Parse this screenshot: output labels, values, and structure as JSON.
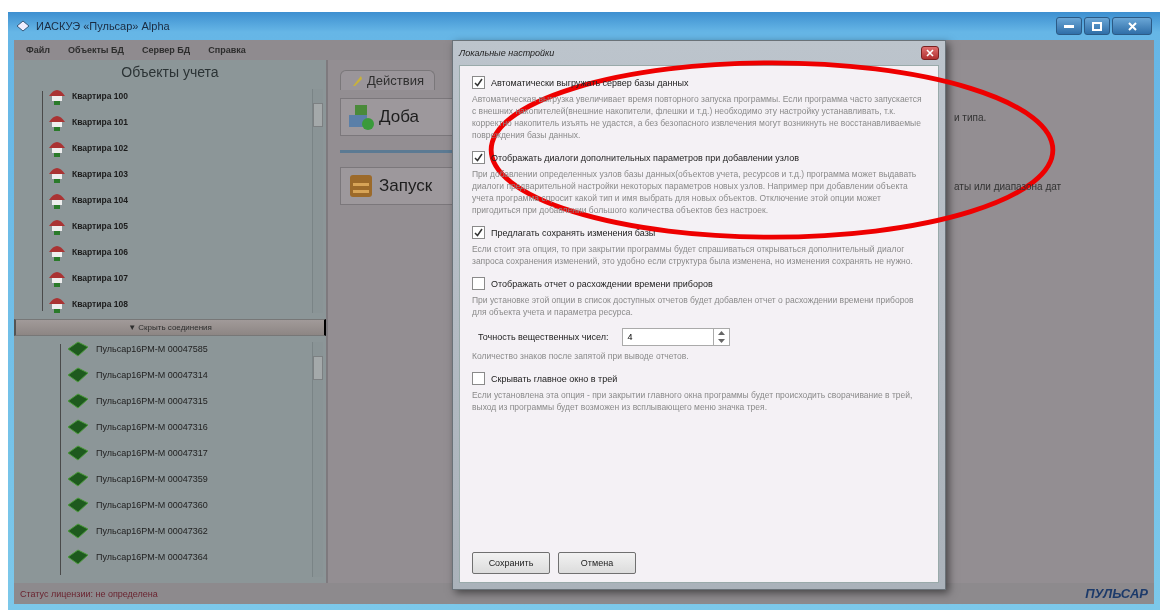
{
  "window": {
    "title": "ИАСКУЭ «Пульсар» Alpha"
  },
  "menu": [
    "Файл",
    "Объекты БД",
    "Сервер БД",
    "Справка"
  ],
  "objects_panel": {
    "title": "Объекты учета",
    "items": [
      "Квартира 100",
      "Квартира 101",
      "Квартира 102",
      "Квартира 103",
      "Квартира 104",
      "Квартира 105",
      "Квартира 106",
      "Квартира 107",
      "Квартира 108"
    ]
  },
  "connections_toggle": {
    "icon": "▼",
    "label": "Скрыть соединения"
  },
  "devices": [
    "Пульсар16РМ-М 00047585",
    "Пульсар16РМ-М 00047314",
    "Пульсар16РМ-М 00047315",
    "Пульсар16РМ-М 00047316",
    "Пульсар16РМ-М 00047317",
    "Пульсар16РМ-М 00047359",
    "Пульсар16РМ-М 00047360",
    "Пульсар16РМ-М 00047362",
    "Пульсар16РМ-М 00047364"
  ],
  "actions": {
    "tab": "Действия",
    "items": [
      {
        "kind": "add",
        "label": "Доба",
        "note": "и типа."
      },
      {
        "kind": "run",
        "label": "Запуск",
        "note": "аты или диапазона дат"
      }
    ]
  },
  "status_bar": "Статус лицензии:  не определена",
  "logo": "ПУЛЬСАР",
  "dialog": {
    "title": "Локальные настройки",
    "settings": [
      {
        "kind": "checkbox",
        "label": "Автоматически выгружать сервер базы данных",
        "checked": true,
        "description": "Автоматическая выгрузка увеличивает время повторного запуска программы. Если программа часто запускается с внешних накопителей(внешние накопители, флешки и т.д.) необходимо эту настройку устанавливать, т.к. корректно накопитель изъять не удастся, а без безопасного извлечения могут возникнуть не восстанавливаемые повреждения базы данных."
      },
      {
        "kind": "checkbox",
        "label": "Отображать диалоги дополнительных параметров при добавлении узлов",
        "checked": true,
        "description": "При добавлении определенных узлов базы данных(объектов учета, ресурсов и т.д.) программа может выдавать диалоги предварительной настройки некоторых параметров новых узлов. Например при добавлении объекта учета программа спросит какой тип и имя выбрать для новых объектов. Отключение этой опции может пригодиться при добавлении большого количества объектов без настроек."
      },
      {
        "kind": "checkbox",
        "label": "Предлагать сохранять изменения базы",
        "checked": true,
        "description": "Если стоит эта опция, то при закрытии программы будет спрашиваться открываться дополнительный диалог запроса сохранения изменений, это удобно если структура была изменена, но изменения сохранять не нужно."
      },
      {
        "kind": "checkbox",
        "label": "Отображать отчет о расхождении времени приборов",
        "checked": false,
        "description": "При установке этой опции в список доступных отчетов будет добавлен отчет о расхождении времени приборов для объекта учета и параметра ресурса."
      },
      {
        "kind": "number",
        "label": "Точность вещественных чисел:",
        "value": "4",
        "description": "Количество знаков после запятой при выводе отчетов."
      },
      {
        "kind": "checkbox",
        "label": "Скрывать главное окно в трей",
        "checked": false,
        "description": "Если установлена эта опция - при закрытии главного окна программы будет происходить сворачивание в трей, выход из программы будет возможен из всплывающего меню значка трея."
      }
    ],
    "buttons": [
      "Сохранить",
      "Отмена"
    ]
  }
}
